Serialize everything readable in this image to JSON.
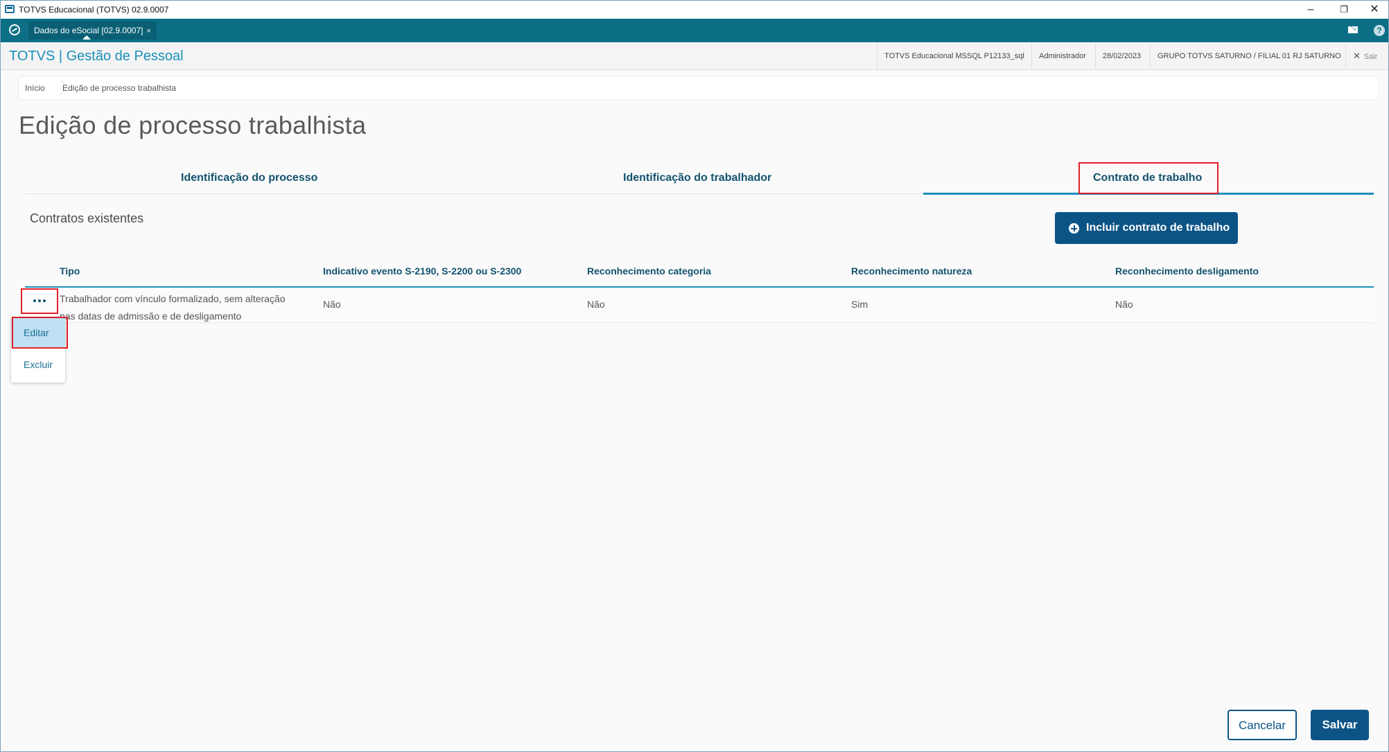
{
  "window": {
    "title": "TOTVS Educacional (TOTVS) 02.9.0007",
    "minimize": "–",
    "restore": "❐",
    "close": "✕"
  },
  "tabs": {
    "active_tab": "Dados do eSocial [02.9.0007]",
    "active_tab_close": "×"
  },
  "header": {
    "product": "TOTVS | Gestão de Pessoal",
    "database": "TOTVS Educacional MSSQL P12133_sql",
    "user": "Administrador",
    "date": "28/02/2023",
    "branch": "GRUPO TOTVS SATURNO / FILIAL 01 RJ SATURNO",
    "logout": "Sair",
    "logout_icon": "✕"
  },
  "breadcrumb": {
    "home": "Início",
    "current": "Edição de processo trabalhista"
  },
  "page": {
    "title": "Edição de processo trabalhista"
  },
  "steps": [
    {
      "label": "Identificação do processo"
    },
    {
      "label": "Identificação do trabalhador"
    },
    {
      "label": "Contrato de trabalho"
    }
  ],
  "section": {
    "title": "Contratos existentes",
    "add_button": "Incluir contrato de trabalho"
  },
  "table": {
    "columns": [
      "Tipo",
      "Indicativo evento S-2190, S-2200 ou S-2300",
      "Reconhecimento categoria",
      "Reconhecimento natureza",
      "Reconhecimento desligamento"
    ],
    "rows": [
      {
        "tipo_line1": "Trabalhador com vínculo formalizado, sem alteração",
        "tipo_line2": "nas datas de admissão e de desligamento",
        "indicativo": "Não",
        "categoria": "Não",
        "natureza": "Sim",
        "desligamento": "Não"
      }
    ]
  },
  "row_menu": {
    "edit": "Editar",
    "delete": "Excluir"
  },
  "footer": {
    "cancel": "Cancelar",
    "save": "Salvar"
  },
  "colors": {
    "brand_teal": "#0c6f86",
    "accent_blue": "#1a8fb9",
    "primary_button": "#0c5486",
    "highlight_red": "#e0202a",
    "menu_hover": "#bfe1f3"
  }
}
